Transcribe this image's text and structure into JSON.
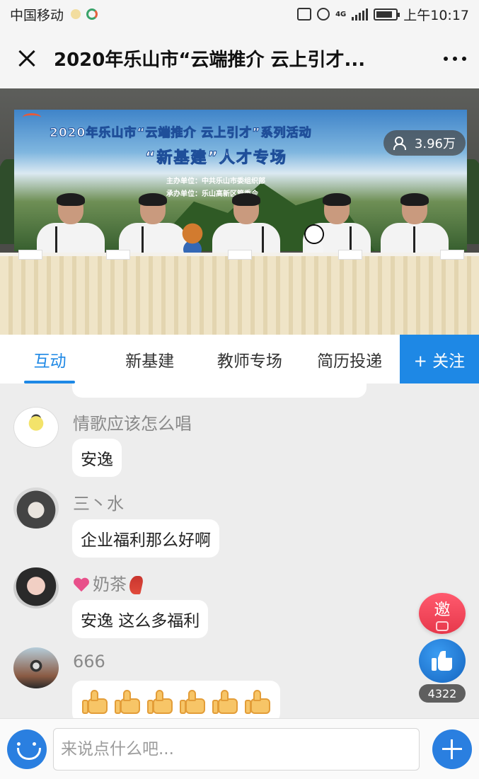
{
  "status_bar": {
    "carrier": "中国移动",
    "network": "4G",
    "time": "上午10:17"
  },
  "header": {
    "title": "2020年乐山市“云端推介 云上引才..."
  },
  "video": {
    "banner_line1": "2020年乐山市“云端推介 云上引才”系列活动",
    "banner_line2": "“新基建”人才专场",
    "organizer": "主办单位：中共乐山市委组织部",
    "co_organizer": "承办单位：乐山高新区管委会",
    "viewers": "3.96万"
  },
  "tabs": [
    {
      "label": "互动",
      "active": true
    },
    {
      "label": "新基建",
      "active": false
    },
    {
      "label": "教师专场",
      "active": false
    },
    {
      "label": "简历投递",
      "active": false
    }
  ],
  "follow_label": "+ 关注",
  "messages": [
    {
      "user": "情歌应该怎么唱",
      "text": "安逸"
    },
    {
      "user": "三丶水",
      "text": "企业福利那么好啊"
    },
    {
      "user": "奶茶",
      "text": "安逸 这么多福利"
    },
    {
      "user": "666",
      "text": ""
    }
  ],
  "actions": {
    "invite_label": "邀",
    "like_count": "4322"
  },
  "input": {
    "placeholder": "来说点什么吧..."
  },
  "colors": {
    "accent": "#1e88e5",
    "invite": "#e7384b",
    "heart": "#e8508a"
  }
}
